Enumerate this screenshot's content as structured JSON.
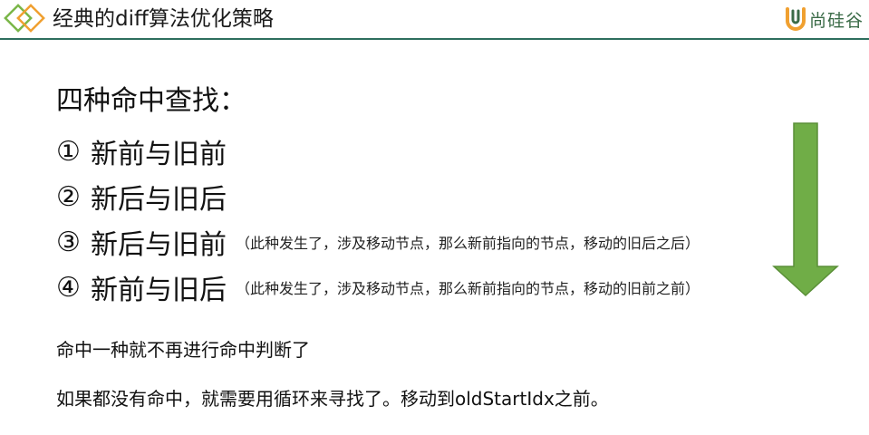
{
  "header": {
    "title": "经典的diff算法优化策略",
    "brand": "尚硅谷",
    "logo_icon": "overlapping-diamonds-icon",
    "brand_icon": "brand-u-icon",
    "accent_color": "#2e6e5e",
    "logo_green": "#7ab648",
    "logo_orange": "#f0a030"
  },
  "main": {
    "heading": "四种命中查找：",
    "strategies": [
      {
        "num": "①",
        "label": "新前与旧前",
        "note": ""
      },
      {
        "num": "②",
        "label": "新后与旧后",
        "note": ""
      },
      {
        "num": "③",
        "label": "新后与旧前",
        "note": "（此种发生了，涉及移动节点，那么新前指向的节点，移动的旧后之后）"
      },
      {
        "num": "④",
        "label": "新前与旧后",
        "note": "（此种发生了，涉及移动节点，那么新前指向的节点，移动的旧前之前）"
      }
    ],
    "note_1": "命中一种就不再进行命中判断了",
    "note_2": "如果都没有命中，就需要用循环来寻找了。移动到oldStartIdx之前。",
    "arrow_icon": "down-arrow-icon",
    "arrow_color": "#70ad47"
  }
}
